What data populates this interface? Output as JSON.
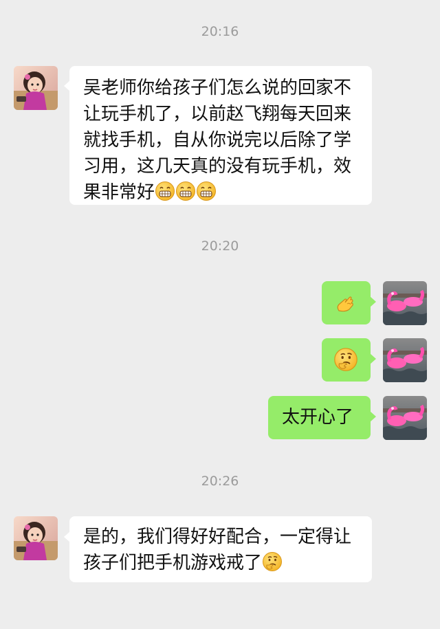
{
  "chat": {
    "timestamps": [
      "20:16",
      "20:20",
      "20:26"
    ],
    "messages": [
      {
        "sender": "other",
        "text": "吴老师你给孩子们怎么说的回家不让玩手机了，以前赵飞翔每天回来就找手机，自从你说完以后除了学习用，这几天真的没有玩手机，效果非常好",
        "trailing_emojis": [
          "grin-face-icon",
          "grin-face-icon",
          "grin-face-icon"
        ]
      },
      {
        "sender": "me",
        "emoji_only": "ok-hand-icon"
      },
      {
        "sender": "me",
        "emoji_only": "thinking-face-icon"
      },
      {
        "sender": "me",
        "text": "太开心了"
      },
      {
        "sender": "other",
        "text": "是的，我们得好好配合，一定得让孩子们把手机游戏戒了",
        "trailing_emojis": [
          "thinking-face-icon"
        ]
      }
    ],
    "colors": {
      "background": "#ededed",
      "incoming_bubble": "#ffffff",
      "outgoing_bubble": "#95ec69",
      "timestamp": "#9b9b9b"
    }
  }
}
